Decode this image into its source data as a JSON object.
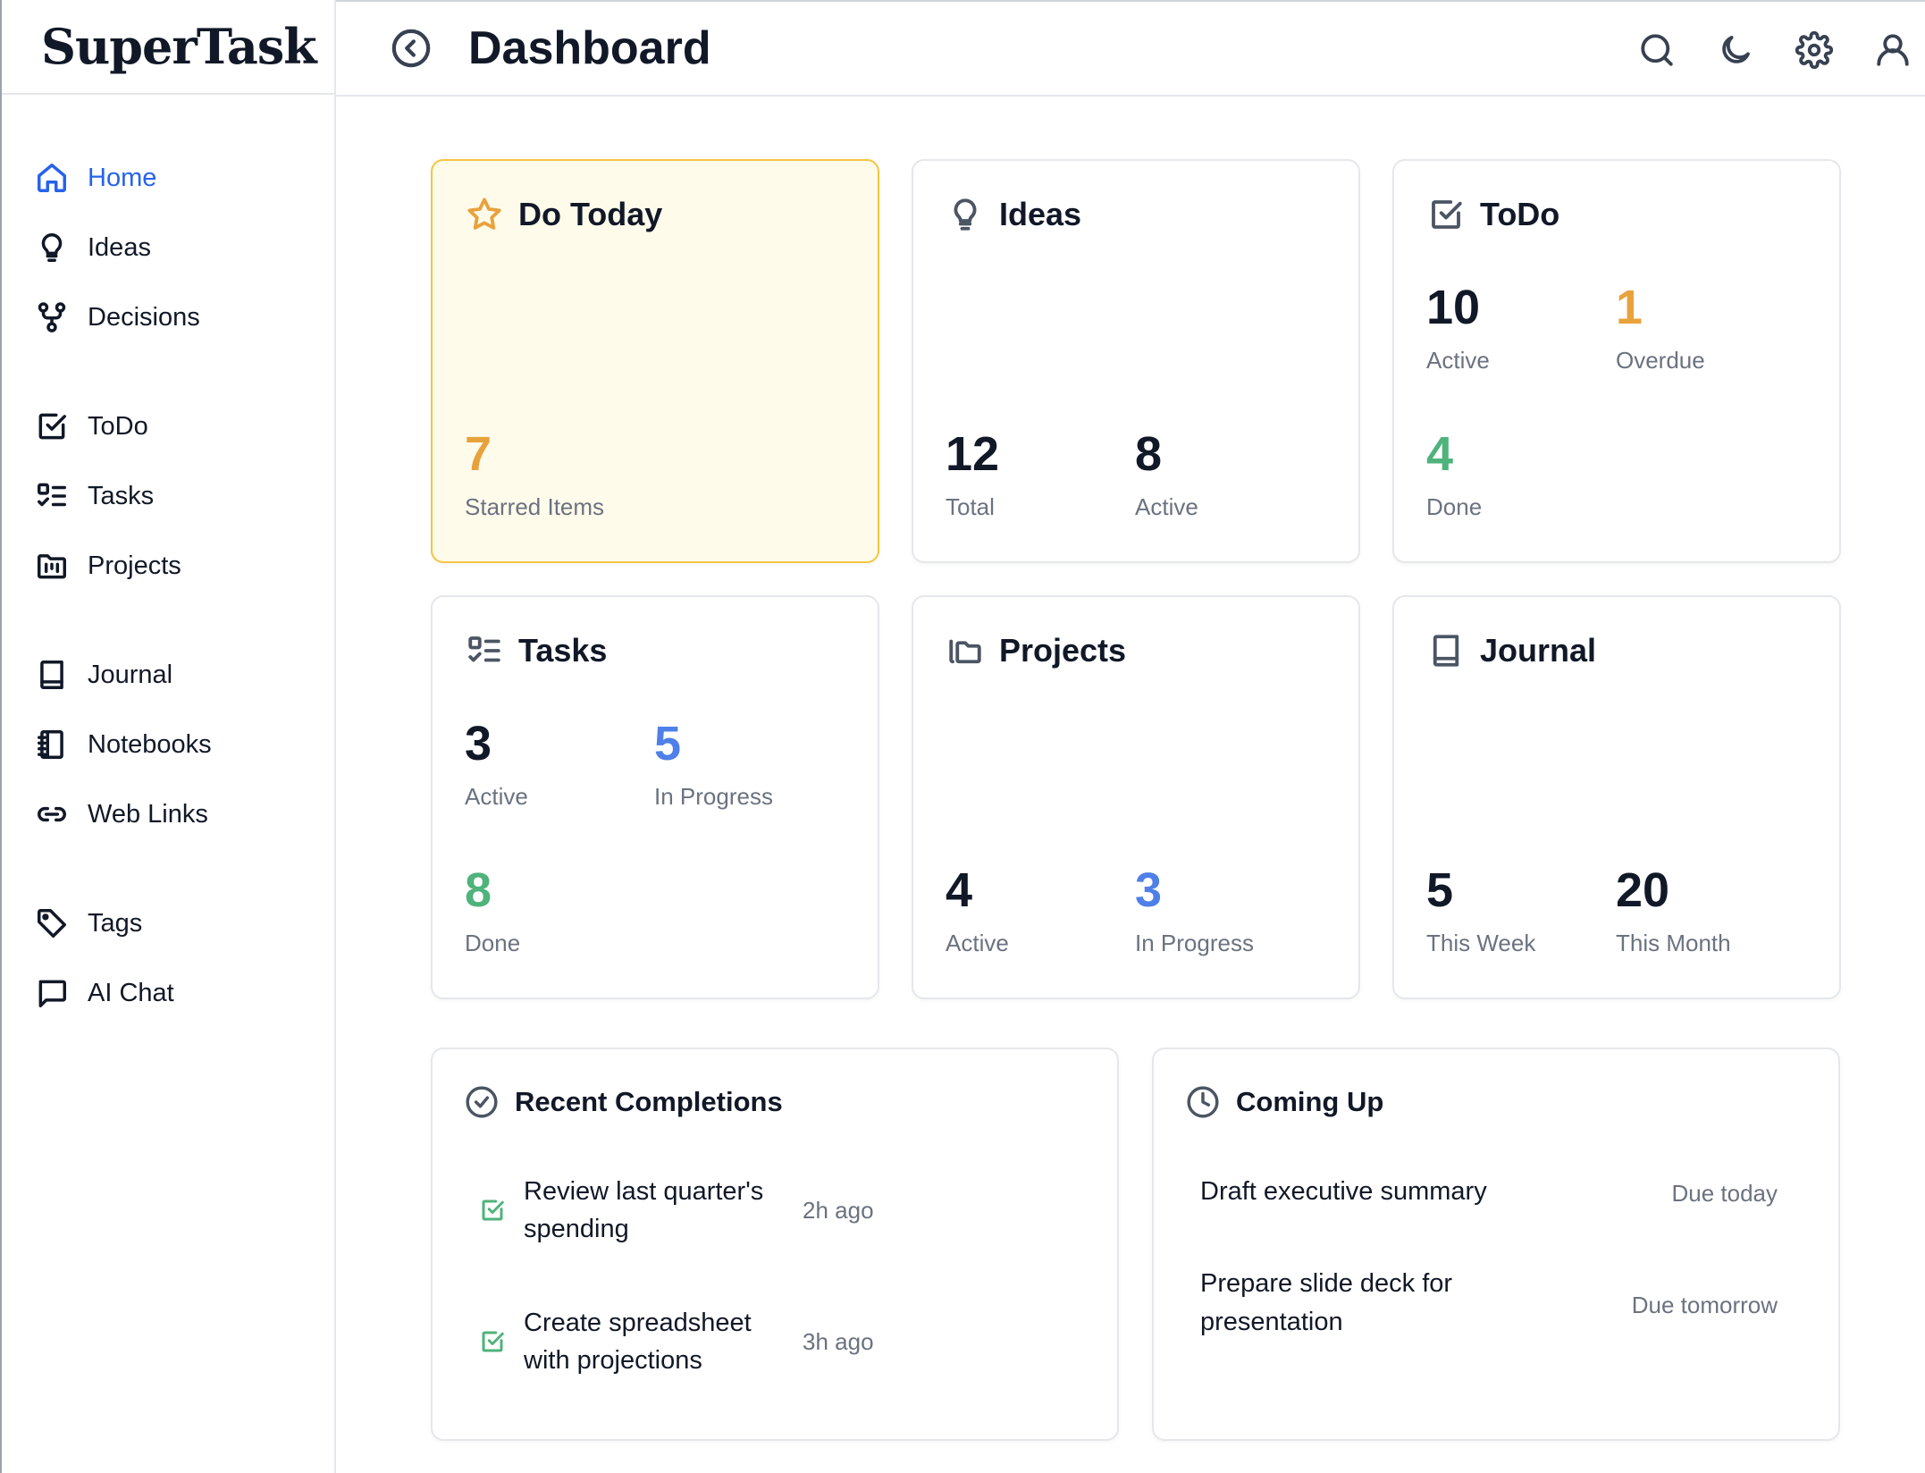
{
  "brand": "SuperTask",
  "header": {
    "title": "Dashboard"
  },
  "sidebar": {
    "items": [
      {
        "label": "Home",
        "icon": "home-icon",
        "active": true
      },
      {
        "label": "Ideas",
        "icon": "lightbulb-icon"
      },
      {
        "label": "Decisions",
        "icon": "branch-icon"
      },
      {
        "label": "ToDo",
        "icon": "checkbox-icon"
      },
      {
        "label": "Tasks",
        "icon": "task-list-icon"
      },
      {
        "label": "Projects",
        "icon": "project-folder-icon"
      },
      {
        "label": "Journal",
        "icon": "book-icon"
      },
      {
        "label": "Notebooks",
        "icon": "notebook-icon"
      },
      {
        "label": "Web Links",
        "icon": "link-icon"
      },
      {
        "label": "Tags",
        "icon": "tag-icon"
      },
      {
        "label": "AI Chat",
        "icon": "chat-icon"
      }
    ]
  },
  "cards": {
    "do_today": {
      "title": "Do Today",
      "starred_value": "7",
      "starred_label": "Starred Items"
    },
    "ideas": {
      "title": "Ideas",
      "total_value": "12",
      "total_label": "Total",
      "active_value": "8",
      "active_label": "Active"
    },
    "todo": {
      "title": "ToDo",
      "active_value": "10",
      "active_label": "Active",
      "overdue_value": "1",
      "overdue_label": "Overdue",
      "done_value": "4",
      "done_label": "Done"
    },
    "tasks": {
      "title": "Tasks",
      "active_value": "3",
      "active_label": "Active",
      "progress_value": "5",
      "progress_label": "In Progress",
      "done_value": "8",
      "done_label": "Done"
    },
    "projects": {
      "title": "Projects",
      "active_value": "4",
      "active_label": "Active",
      "progress_value": "3",
      "progress_label": "In Progress"
    },
    "journal": {
      "title": "Journal",
      "week_value": "5",
      "week_label": "This Week",
      "month_value": "20",
      "month_label": "This Month"
    }
  },
  "recent": {
    "title": "Recent Completions",
    "items": [
      {
        "text": "Review last quarter's spending",
        "time": "2h ago"
      },
      {
        "text": "Create spreadsheet with projections",
        "time": "3h ago"
      }
    ]
  },
  "upcoming": {
    "title": "Coming Up",
    "items": [
      {
        "text": "Draft executive summary",
        "due": "Due today"
      },
      {
        "text": "Prepare slide deck for presentation",
        "due": "Due tomorrow"
      }
    ]
  },
  "colors": {
    "accent": "#2563eb",
    "orange": "#e8a23d",
    "green": "#4fb37b",
    "blue": "#4f7fe8",
    "highlight_bg": "#fffbeb",
    "highlight_border": "#f5c542"
  }
}
